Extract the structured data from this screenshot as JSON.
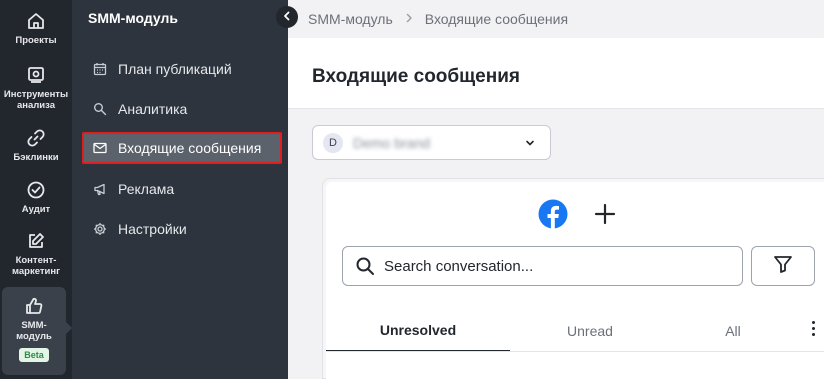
{
  "rail": {
    "items": [
      {
        "label": "Проекты",
        "icon": "home-icon"
      },
      {
        "label": "Инструменты анализа",
        "icon": "analysis-tools-icon"
      },
      {
        "label": "Бэклинки",
        "icon": "link-icon"
      },
      {
        "label": "Аудит",
        "icon": "check-circle-icon"
      },
      {
        "label": "Контент-маркетинг",
        "icon": "edit-icon"
      },
      {
        "label": "SMM-модуль",
        "icon": "thumbs-up-icon",
        "badge": "Beta"
      }
    ]
  },
  "sidebar": {
    "title": "SMM-модуль",
    "items": [
      {
        "label": "План публикаций",
        "icon": "calendar-icon"
      },
      {
        "label": "Аналитика",
        "icon": "magnifier-icon"
      },
      {
        "label": "Входящие сообщения",
        "icon": "mail-icon"
      },
      {
        "label": "Реклама",
        "icon": "megaphone-icon"
      },
      {
        "label": "Настройки",
        "icon": "gear-icon"
      }
    ]
  },
  "breadcrumb": {
    "root": "SMM-модуль",
    "current": "Входящие сообщения"
  },
  "page": {
    "title": "Входящие сообщения"
  },
  "brand_select": {
    "avatar_letter": "D",
    "value": "Demo brand"
  },
  "inbox": {
    "search_placeholder": "Search conversation...",
    "tabs": [
      {
        "label": "Unresolved"
      },
      {
        "label": "Unread"
      },
      {
        "label": "All"
      }
    ]
  },
  "colors": {
    "rail_bg": "#22272e",
    "sidebar_bg": "#2d343d",
    "active_item_bg": "#5b626b",
    "highlight_border": "#e01e1e",
    "facebook": "#1877f2",
    "beta_bg": "#e3f5e7",
    "beta_text": "#2e8a45"
  }
}
